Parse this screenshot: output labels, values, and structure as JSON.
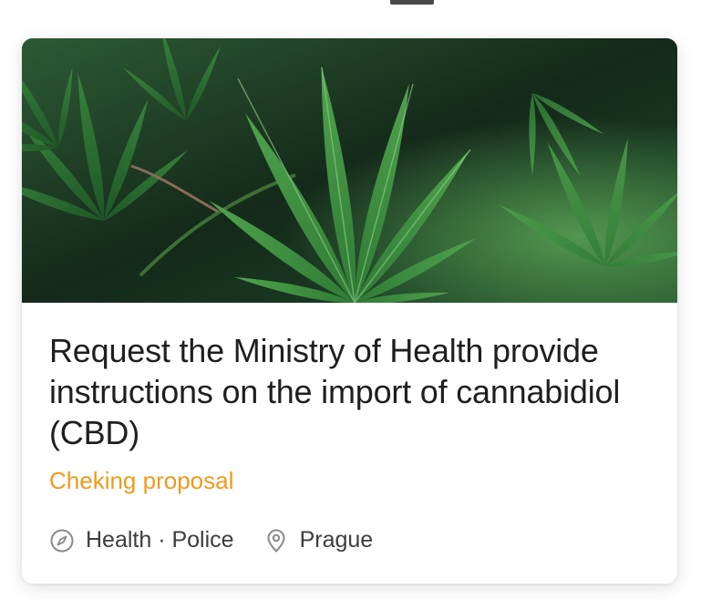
{
  "proposal": {
    "title": "Request the Ministry of Health provide instructions on the import of cannabidiol (CBD)",
    "status": "Cheking proposal",
    "status_color": "#ef9a1c",
    "image": "cannabis-leaves-photo",
    "category_icon": "compass-icon",
    "categories": "Health · Police",
    "location_icon": "location-pin-icon",
    "location": "Prague"
  }
}
